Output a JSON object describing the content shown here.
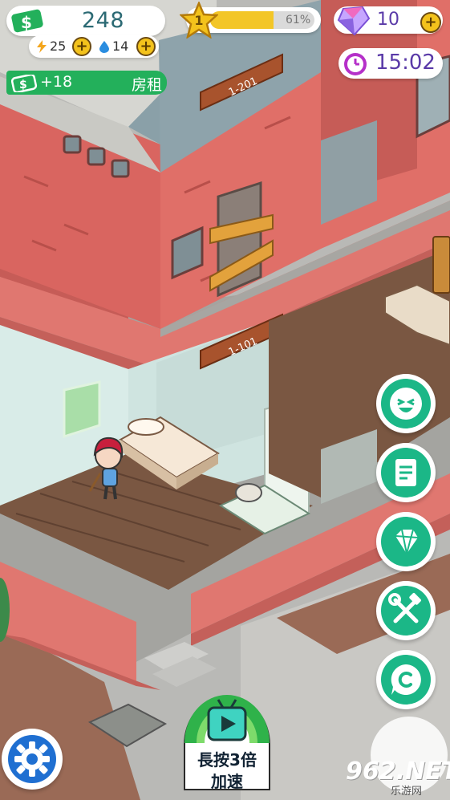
{
  "hud": {
    "money": "248",
    "energy": "25",
    "water": "14",
    "rent_amount": "+18",
    "rent_label": "房租",
    "level": "1",
    "xp_percent_text": "61%",
    "xp_progress": 0.61,
    "gems": "10",
    "clock": "15:02"
  },
  "rooms": {
    "upper_sign": "1-201",
    "lower_sign": "1-101"
  },
  "side_buttons": [
    {
      "name": "emoji-button",
      "icon": "laughing-face-icon"
    },
    {
      "name": "tasks-button",
      "icon": "notepad-icon"
    },
    {
      "name": "gem-shop-button",
      "icon": "diamond-icon"
    },
    {
      "name": "build-button",
      "icon": "wrench-hammer-icon"
    },
    {
      "name": "coin-button",
      "icon": "copyright-coin-icon"
    }
  ],
  "speed_button": {
    "line1": "長按3倍",
    "line2": "加速",
    "icon": "tv-play-icon"
  },
  "watermark": {
    "main": "962.NET",
    "sub": "乐游网"
  },
  "colors": {
    "money_green": "#23b05b",
    "accent_teal": "#1bb787",
    "gem_purple": "#5a3aa8",
    "gold": "#f3c21c",
    "brick_red": "#d96560"
  }
}
